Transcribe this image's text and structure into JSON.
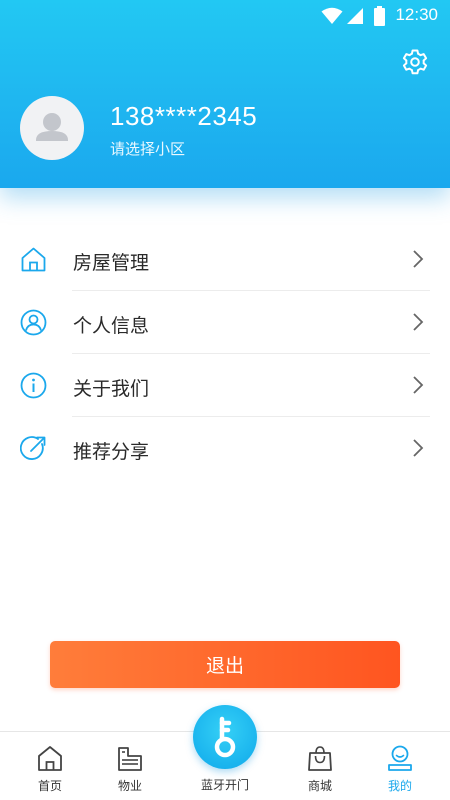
{
  "status_bar": {
    "time": "12:30"
  },
  "profile": {
    "phone": "138****2345",
    "community_prompt": "请选择小区"
  },
  "menu": {
    "items": [
      {
        "label": "房屋管理",
        "icon": "home-icon"
      },
      {
        "label": "个人信息",
        "icon": "user-icon"
      },
      {
        "label": "关于我们",
        "icon": "info-icon"
      },
      {
        "label": "推荐分享",
        "icon": "share-icon"
      }
    ]
  },
  "logout_label": "退出",
  "tabbar": {
    "items": [
      {
        "label": "首页",
        "icon": "home-tab-icon"
      },
      {
        "label": "物业",
        "icon": "property-tab-icon"
      },
      {
        "label": "蓝牙开门",
        "icon": "key-icon"
      },
      {
        "label": "商城",
        "icon": "shopping-bag-icon"
      },
      {
        "label": "我的",
        "icon": "profile-tab-icon",
        "active": true
      }
    ]
  },
  "colors": {
    "primary": "#1fb6f0",
    "accent": "#ff6a2b",
    "icon_blue": "#1ba8ec"
  }
}
